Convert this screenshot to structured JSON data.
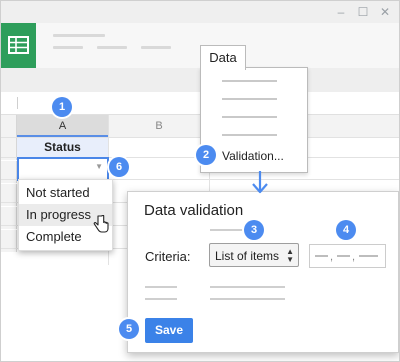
{
  "window_controls": {
    "minimize": "–",
    "maximize": "☐",
    "close": "✕"
  },
  "columns": {
    "a": "A",
    "b": "B"
  },
  "sheet": {
    "header_cell": "Status",
    "dropdown_options": [
      "Not started",
      "In progress",
      "Complete"
    ],
    "hovered_option": "In progress"
  },
  "data_menu": {
    "tab_label": "Data",
    "validation_item": "Validation..."
  },
  "dialog": {
    "title": "Data validation",
    "criteria_label": "Criteria:",
    "criteria_select": "List of items",
    "values_placeholder": "— , — , —",
    "save_label": "Save"
  },
  "badges": [
    "1",
    "2",
    "3",
    "4",
    "5",
    "6"
  ],
  "colors": {
    "accent": "#4c8bf0",
    "app_green": "#2e9e5b",
    "selection": "#4a86e8"
  },
  "icons": {
    "app": "sheets-icon",
    "cursor": "hand-pointer-icon",
    "arrow": "arrow-down-icon"
  }
}
